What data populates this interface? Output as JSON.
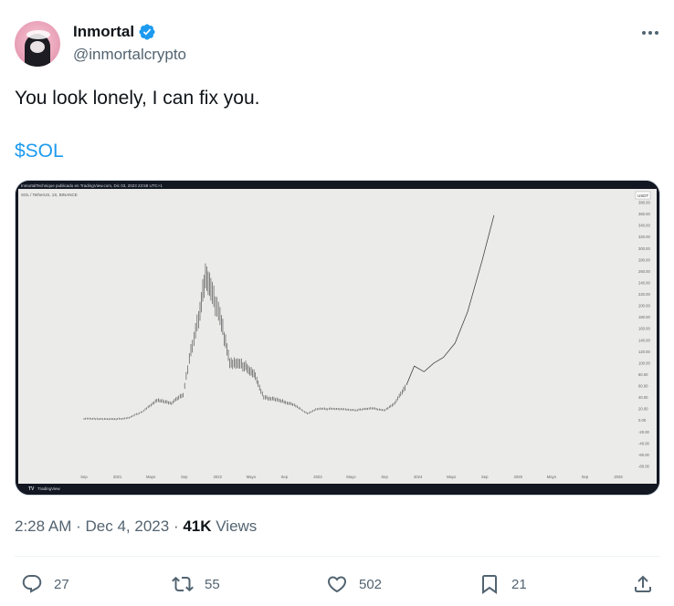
{
  "author": {
    "display_name": "Inmortal",
    "handle": "@inmortalcrypto"
  },
  "tweet": {
    "text": "You look lonely, I can fix you.",
    "cashtag": "$SOL"
  },
  "chart_image": {
    "header_text": "InmortalTechnique publicado en TradingView.com, Dic 03, 2023 23:58 UTC+1",
    "symbol_text": "SOL / TetherUS, 1S, BINANCE",
    "currency_badge": "USDT",
    "footer_brand": "TradingView",
    "chart_data": {
      "type": "line",
      "title": "",
      "xlabel": "",
      "ylabel": "",
      "x_ticks": [
        "Sep",
        "2021",
        "Mayo",
        "Sep",
        "2022",
        "Mayo",
        "Sep",
        "2023",
        "Mayo",
        "Sep",
        "2024",
        "Mayo",
        "Sep",
        "2025",
        "Mayo",
        "Sep",
        "2026"
      ],
      "y_ticks": [
        "380.00",
        "360.00",
        "340.00",
        "320.00",
        "300.00",
        "280.00",
        "260.00",
        "240.00",
        "220.00",
        "200.00",
        "180.00",
        "160.00",
        "140.00",
        "120.00",
        "100.00",
        "80.00",
        "60.00",
        "40.00",
        "20.00",
        "0.00",
        "-20.00",
        "-40.00",
        "-60.00",
        "-80.00"
      ],
      "ylim": [
        -80,
        380
      ],
      "series": [
        {
          "values": [
            [
              2020.6,
              3
            ],
            [
              2020.9,
              2
            ],
            [
              2021.05,
              4
            ],
            [
              2021.2,
              15
            ],
            [
              2021.35,
              35
            ],
            [
              2021.5,
              30
            ],
            [
              2021.62,
              45
            ],
            [
              2021.7,
              120
            ],
            [
              2021.78,
              175
            ],
            [
              2021.85,
              255
            ],
            [
              2021.92,
              220
            ],
            [
              2022.0,
              180
            ],
            [
              2022.1,
              100
            ],
            [
              2022.25,
              95
            ],
            [
              2022.35,
              80
            ],
            [
              2022.45,
              40
            ],
            [
              2022.6,
              35
            ],
            [
              2022.75,
              28
            ],
            [
              2022.9,
              12
            ],
            [
              2023.0,
              20
            ],
            [
              2023.2,
              20
            ],
            [
              2023.4,
              18
            ],
            [
              2023.55,
              21
            ],
            [
              2023.7,
              18
            ],
            [
              2023.8,
              30
            ],
            [
              2023.92,
              62
            ]
          ],
          "style": "candles"
        },
        {
          "values": [
            [
              2023.92,
              62
            ],
            [
              2024.0,
              95
            ],
            [
              2024.1,
              85
            ],
            [
              2024.2,
              100
            ],
            [
              2024.3,
              110
            ],
            [
              2024.42,
              135
            ],
            [
              2024.55,
              190
            ],
            [
              2024.7,
              280
            ],
            [
              2024.82,
              358
            ]
          ],
          "style": "projection"
        }
      ]
    }
  },
  "meta": {
    "time": "2:28 AM",
    "date": "Dec 4, 2023",
    "separator": "·",
    "views_count": "41K",
    "views_label": "Views"
  },
  "actions": {
    "replies": "27",
    "retweets": "55",
    "likes": "502",
    "bookmarks": "21"
  },
  "colors": {
    "accent": "#1d9bf0",
    "text_primary": "#0f1419",
    "text_secondary": "#536471",
    "chart_bg": "#ebebea"
  }
}
